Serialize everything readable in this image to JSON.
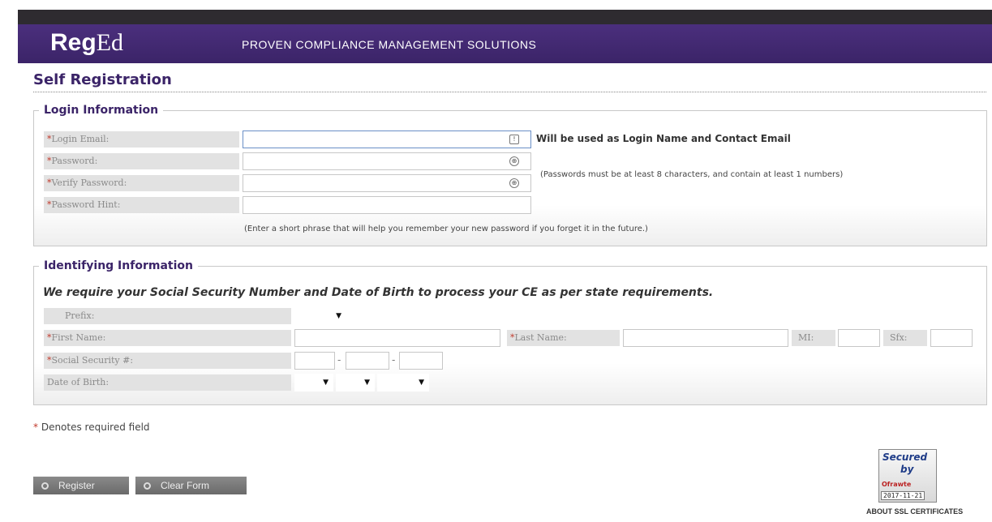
{
  "header": {
    "logo_bold": "Reg",
    "logo_serif": "Ed",
    "tagline": "PROVEN COMPLIANCE MANAGEMENT SOLUTIONS"
  },
  "page": {
    "title": "Self Registration"
  },
  "login": {
    "legend": "Login Information",
    "fields": {
      "email_label": "Login Email:",
      "password_label": "Password:",
      "verify_label": "Verify Password:",
      "hint_label": "Password Hint:"
    },
    "email_note": "Will be used as Login Name and Contact Email",
    "password_note": "(Passwords must be at least 8 characters, and contain at least 1 numbers)",
    "hint_note": "(Enter a short phrase that will help you remember your new password if you forget it in the future.)"
  },
  "identity": {
    "legend": "Identifying Information",
    "intro": "We require your Social Security Number and Date of Birth to process your CE as per state requirements.",
    "prefix_label": "Prefix:",
    "first_name_label": "First Name:",
    "last_name_label": "Last Name:",
    "mi_label": "MI:",
    "sfx_label": "Sfx:",
    "ssn_label": "Social Security #:",
    "dob_label": "Date of Birth:",
    "ssn_separator": "-",
    "dropdown_arrow": "▼"
  },
  "required_marker": "*",
  "required_note": "Denotes required field",
  "buttons": {
    "register": "Register",
    "clear": "Clear Form"
  },
  "seal": {
    "line1": "Secured",
    "line2": "by",
    "brand": "Ofrawte",
    "date": "2017-11-21",
    "caption": "ABOUT SSL CERTIFICATES"
  },
  "icons": {
    "email_field_icon": "exclamation-icon",
    "password_field_icon": "key-icon"
  },
  "colors": {
    "brand_purple": "#3b2468",
    "required_red": "#c0392b"
  }
}
